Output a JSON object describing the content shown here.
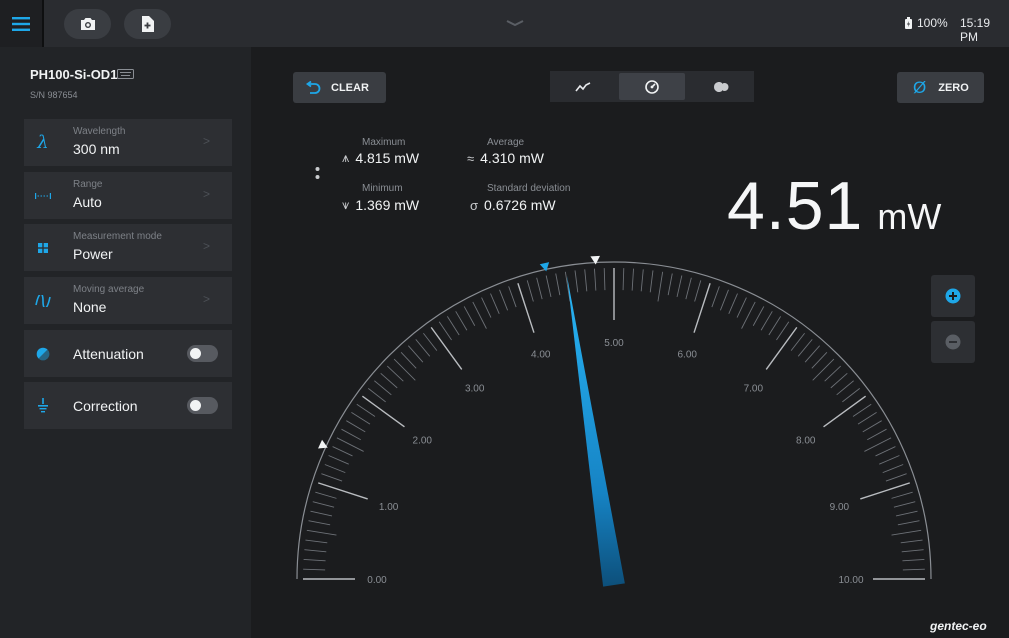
{
  "topbar": {
    "menu_icon": "hamburger-icon",
    "camera_icon": "camera-icon",
    "export_icon": "file-plus-icon",
    "chevron_icon": "chevron-down-icon",
    "battery_icon": "battery-icon",
    "battery": "100%",
    "time": "15:19 PM"
  },
  "device": {
    "name": "PH100-Si-OD1",
    "serial": "S/N 987654",
    "keyboard_icon": "keyboard-icon"
  },
  "settings": [
    {
      "label": "Wavelength",
      "value": "300 nm",
      "icon": "lambda-icon"
    },
    {
      "label": "Range",
      "value": "Auto",
      "icon": "range-icon"
    },
    {
      "label": "Measurement mode",
      "value": "Power",
      "icon": "grid-icon"
    },
    {
      "label": "Moving average",
      "value": "None",
      "icon": "wave-icon"
    }
  ],
  "toggles": [
    {
      "label": "Attenuation",
      "icon": "attenuation-icon",
      "on": false
    },
    {
      "label": "Correction",
      "icon": "correction-icon",
      "on": false
    }
  ],
  "toolbar": {
    "clear_label": "CLEAR",
    "zero_label": "ZERO",
    "zero_symbol": "Ø",
    "view_icons": [
      "line-chart-icon",
      "gauge-icon",
      "pulse-icon"
    ],
    "active_view": 1
  },
  "stats": {
    "maximum": {
      "label": "Maximum",
      "value": "4.815 mW",
      "symbol": "⩚"
    },
    "average": {
      "label": "Average",
      "value": "4.310 mW",
      "symbol": "≈"
    },
    "minimum": {
      "label": "Minimum",
      "value": "1.369 mW",
      "symbol": "⩛"
    },
    "stddev": {
      "label": "Standard deviation",
      "value": "0.6726 mW",
      "symbol": "σ"
    }
  },
  "reading": {
    "value": "4.51",
    "unit": "mW"
  },
  "gauge": {
    "min": 0,
    "max": 10,
    "value": 4.51,
    "average": 4.31,
    "maximum": 4.815,
    "minimum": 1.369,
    "labels": [
      "0.00",
      "1.00",
      "2.00",
      "3.00",
      "4.00",
      "5.00",
      "6.00",
      "7.00",
      "8.00",
      "9.00",
      "10.00"
    ],
    "needle_color": "#1ea7e8"
  },
  "zoom": {
    "in_icon": "zoom-in-icon",
    "out_icon": "zoom-out-icon"
  },
  "brand": "gentec-eo",
  "colors": {
    "accent": "#1ea7e8",
    "background": "#1b1c1e",
    "panel": "#2d2f33"
  }
}
